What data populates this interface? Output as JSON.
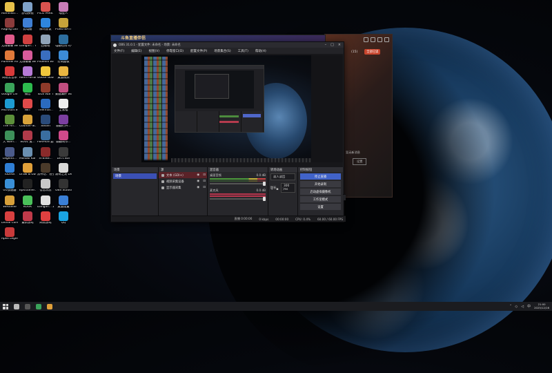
{
  "desktop_icons": [
    {
      "label": "Administr...",
      "color": "#e7c14a"
    },
    {
      "label": "舒切换视",
      "color": "#7fa2c9"
    },
    {
      "label": "PICO PARK 2",
      "color": "#d9534f"
    },
    {
      "label": "喵星人",
      "color": "#c97cb7"
    },
    {
      "label": "Raging Loop",
      "color": "#8a3b3b"
    },
    {
      "label": "此电脑",
      "color": "#3f7fd4"
    },
    {
      "label": "腾讯会议",
      "color": "#2e86de"
    },
    {
      "label": "PUBG BATTLEGR...",
      "color": "#c7a33a"
    },
    {
      "label": "无限暖暖 WeGame版",
      "color": "#e05a8a"
    },
    {
      "label": "Dangan... Trigger H...",
      "color": "#d04040"
    },
    {
      "label": "回收站",
      "color": "#8fa3b8"
    },
    {
      "label": "电脑在用 时手中",
      "color": "#2d6e9e"
    },
    {
      "label": "Pummel Party",
      "color": "#e0793a"
    },
    {
      "label": "无限暖暖 WeGame版",
      "color": "#d85b9b"
    },
    {
      "label": "Phoenix Wright A...",
      "color": "#3a6ebf"
    },
    {
      "label": "控制面板",
      "color": "#3c8bd6"
    },
    {
      "label": "网易云音乐",
      "color": "#d83a3a"
    },
    {
      "label": "Remi Fortune -...",
      "color": "#b57ad6"
    },
    {
      "label": "Goose Goose Duck",
      "color": "#f0c63c"
    },
    {
      "label": "桌面视频",
      "color": "#e9b541"
    },
    {
      "label": "Google Chrome",
      "color": "#3aa35a"
    },
    {
      "label": "微信",
      "color": "#2dbb4e"
    },
    {
      "label": "Total War THREE KI...",
      "color": "#8e3a2a"
    },
    {
      "label": "蒙翻满杯 Wallpaper...",
      "color": "#c04d7f"
    },
    {
      "label": "Microsoft Edge",
      "color": "#1d9bd1"
    },
    {
      "label": "NET",
      "color": "#e04a4a"
    },
    {
      "label": "Thermal...",
      "color": "#2b6bbf"
    },
    {
      "label": "全家福",
      "color": "#eeeeee"
    },
    {
      "label": "The Fin...",
      "color": "#5c8f3a"
    },
    {
      "label": "Counter-St...",
      "color": "#d8a23a"
    },
    {
      "label": "Steam",
      "color": "#2a4b7a"
    },
    {
      "label": "翻翻打开...",
      "color": "#7b3fa0"
    },
    {
      "label": "大 Nam...",
      "color": "#3d8f5a"
    },
    {
      "label": "SOUL 鬼...",
      "color": "#b03a4a"
    },
    {
      "label": "FERMUS 夏新...",
      "color": "#3a6ea0"
    },
    {
      "label": "翻翻制作...",
      "color": "#d04a8a"
    },
    {
      "label": "Legend...",
      "color": "#4a5a8a"
    },
    {
      "label": "Monaki Kanin...",
      "color": "#6a8fb0"
    },
    {
      "label": "STEINS...",
      "color": "#8a2a2a"
    },
    {
      "label": "Let's Bar",
      "color": "#3a3a3a"
    },
    {
      "label": "ToDesk",
      "color": "#2f7fd6"
    },
    {
      "label": "Draw & Guess -...",
      "color": "#e0a03a"
    },
    {
      "label": "黑神话：悟空",
      "color": "#4a3a2a"
    },
    {
      "label": "凌奇之龙 Demo",
      "color": "#d8d8d8"
    },
    {
      "label": "UU加速器",
      "color": "#3a8fd6"
    },
    {
      "label": "EpicGame... -快捷方式",
      "color": "#222222"
    },
    {
      "label": "信息消息",
      "color": "#c8c8c8"
    },
    {
      "label": "OBS Studio",
      "color": "#333333"
    },
    {
      "label": "WeGame",
      "color": "#d8a03a"
    },
    {
      "label": "KOOK",
      "color": "#4ac05a"
    },
    {
      "label": "Dangan... 2 Goodb...",
      "color": "#e0e0e0"
    },
    {
      "label": "桌面设置",
      "color": "#3a7fd6"
    },
    {
      "label": "Lethal Company",
      "color": "#d84040"
    },
    {
      "label": "最新游戏",
      "color": "#c03a4a"
    },
    {
      "label": "网易游戏",
      "color": "#e04040"
    },
    {
      "label": "QQ",
      "color": "#1aa3e0"
    },
    {
      "label": "Apex Legends",
      "color": "#c83a3a"
    }
  ],
  "background_window": {
    "title_glyphs": "斗鱼直播伴侣",
    "row_text": "(15)",
    "row_button": "全部已读",
    "info_text": "暂无新消息",
    "info_button": "设置"
  },
  "obs": {
    "title": "OBS 31.0.1 - 配置文件: 未命名 - 场景: 未命名",
    "menu": [
      "文件(F)",
      "编辑(E)",
      "视图(V)",
      "停靠窗口(D)",
      "配置文件(P)",
      "场景集合(S)",
      "工具(T)",
      "帮助(H)"
    ],
    "context_bar": [
      "未选择源",
      "属性",
      "滤镜"
    ],
    "docks": {
      "scenes": {
        "title": "场景",
        "items": [
          "场景"
        ]
      },
      "sources": {
        "title": "源",
        "items": [
          {
            "label": "文本 (GDI+)",
            "selected": true
          },
          {
            "label": "视频采集设备",
            "selected": false
          },
          {
            "label": "显示器采集",
            "selected": false
          }
        ]
      },
      "mixer": {
        "title": "混音器",
        "channels": [
          {
            "name": "桌面音频",
            "db": "0.0 dB"
          },
          {
            "name": "麦克风",
            "db": "0.0 dB"
          }
        ]
      },
      "transitions": {
        "title": "转场动画",
        "effect": "淡入淡出",
        "duration_label": "时长",
        "duration_value": "300 ms"
      },
      "controls": {
        "title": "控制按钮",
        "buttons": [
          "停止直播",
          "开始录制",
          "启动虚拟摄像机",
          "工作室模式",
          "设置"
        ]
      }
    },
    "status": {
      "live": "直播 0:00:06",
      "bitrate": "0 kbps",
      "rec": "00:00:00",
      "cpu": "CPU: 0.4%",
      "fps": "60.00 / 60.00 FPS"
    }
  },
  "taskbar": {
    "clock_time": "21:00",
    "clock_date": "2025/12/16",
    "sys_lang": "中"
  }
}
